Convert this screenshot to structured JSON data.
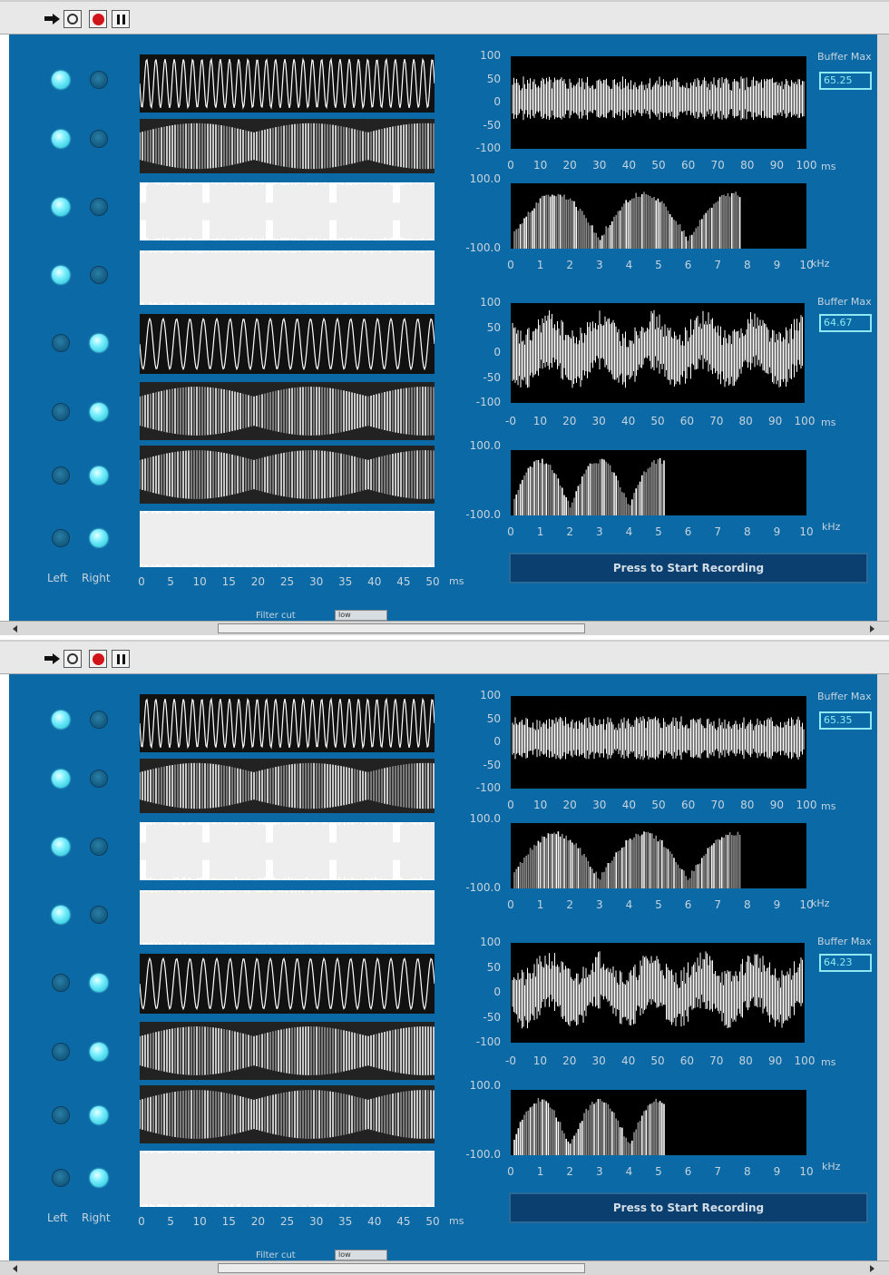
{
  "toolbar": {
    "icons": [
      "run-arrow-icon",
      "run-continuously-icon",
      "abort-icon",
      "pause-icon"
    ]
  },
  "leds": {
    "left": [
      true,
      true,
      true,
      true,
      false,
      false,
      false,
      false
    ],
    "right": [
      false,
      false,
      false,
      false,
      true,
      true,
      true,
      true
    ]
  },
  "labels": {
    "left": "Left",
    "right": "Right"
  },
  "strip_axis": {
    "ticks": [
      "0",
      "5",
      "10",
      "15",
      "20",
      "25",
      "30",
      "35",
      "40",
      "45",
      "50"
    ],
    "unit": "ms"
  },
  "time_plot": {
    "yticks": [
      "100",
      "50",
      "0",
      "-50",
      "-100"
    ],
    "xticks": [
      "0",
      "10",
      "20",
      "30",
      "40",
      "50",
      "60",
      "70",
      "80",
      "90",
      "100"
    ],
    "unit": "ms"
  },
  "time_plot_2": {
    "xticks": [
      "-0",
      "10",
      "20",
      "30",
      "40",
      "50",
      "60",
      "70",
      "80",
      "90",
      "100"
    ]
  },
  "spectrum_plot": {
    "yticks": [
      "100.0",
      "-100.0"
    ],
    "xticks": [
      "0",
      "1",
      "2",
      "3",
      "4",
      "5",
      "6",
      "7",
      "8",
      "9",
      "10"
    ],
    "unit": "kHz",
    "unit_2": "kHz"
  },
  "buffer": {
    "caption": "Buffer Max"
  },
  "windows": [
    {
      "buffer_values": [
        "65.25",
        "64.67"
      ]
    },
    {
      "buffer_values": [
        "65.35",
        "64.23"
      ]
    }
  ],
  "record_button": "Press to Start Recording",
  "filter": {
    "label": "Filter   cut",
    "value": "low"
  },
  "colors": {
    "panel": "#0b6aa5",
    "led_on": "#7ff0ff",
    "plot_bg": "#000000",
    "trace": "#ffffff"
  }
}
